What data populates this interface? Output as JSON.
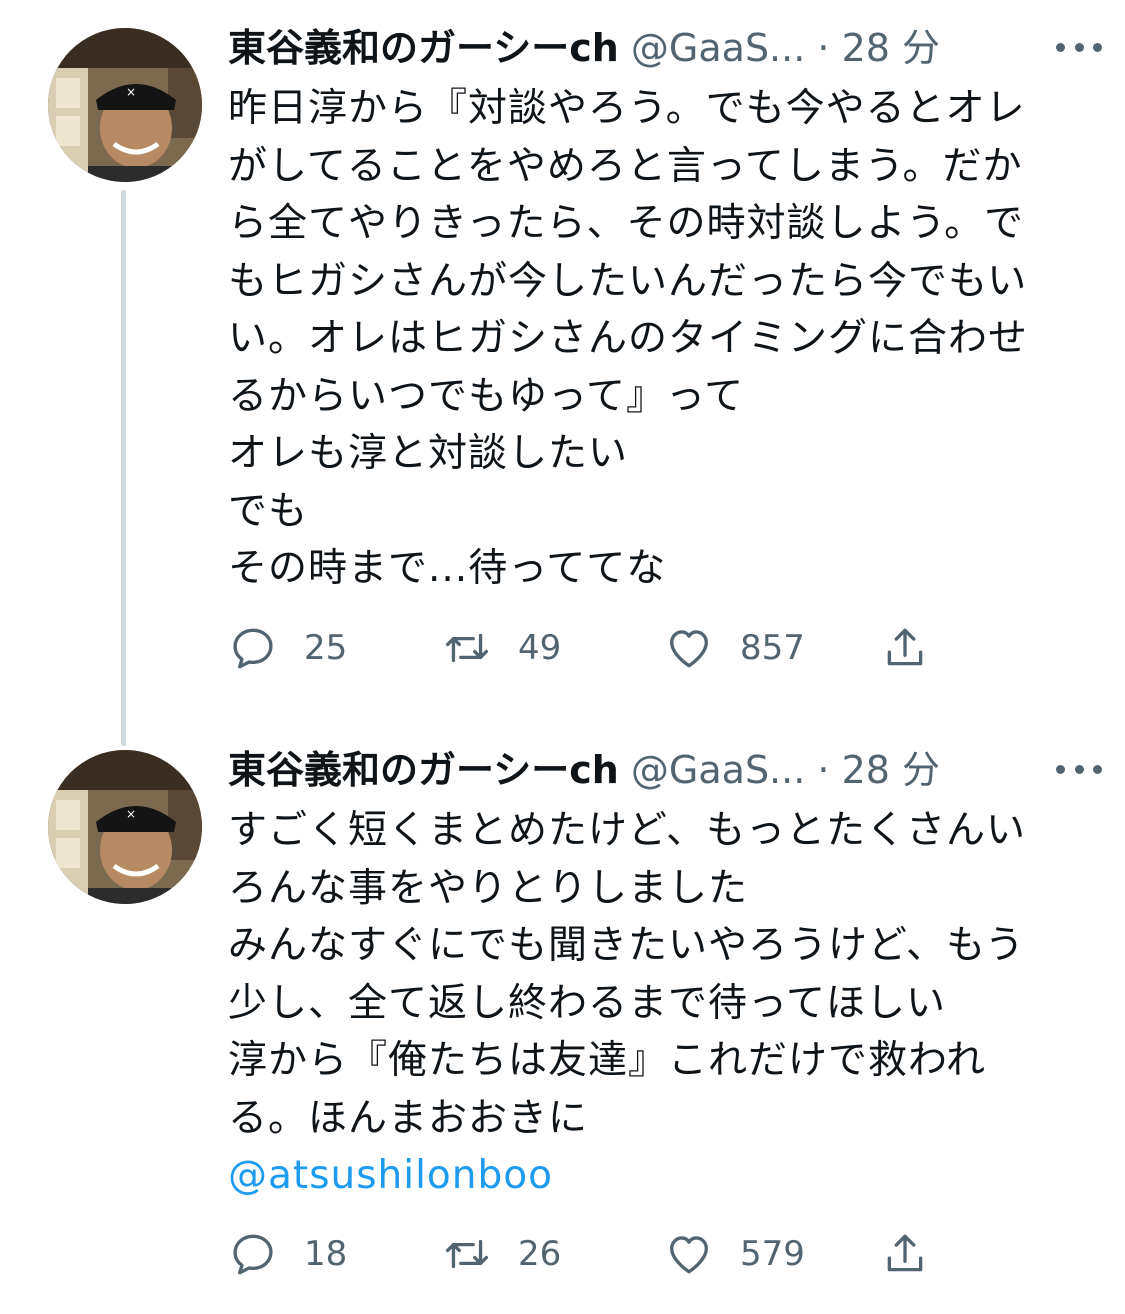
{
  "tweets": [
    {
      "display_name": "東谷義和のガーシーch",
      "handle": "@GaaS...",
      "separator": "·",
      "time": "28 分",
      "lines": [
        "昨日淳から『対談やろう。でも今やるとオレ",
        "がしてることをやめろと言ってしまう。だか",
        "ら全てやりきったら、その時対談しよう。で",
        "もヒガシさんが今したいんだったら今でもい",
        "い。オレはヒガシさんのタイミングに合わせ",
        "るからいつでもゆって』って",
        "オレも淳と対談したい",
        "でも",
        "その時まで...待っててな"
      ],
      "mention": "",
      "replies": "25",
      "retweets": "49",
      "likes": "857"
    },
    {
      "display_name": "東谷義和のガーシーch",
      "handle": "@GaaS...",
      "separator": "·",
      "time": "28 分",
      "lines": [
        "すごく短くまとめたけど、もっとたくさんい",
        "ろんな事をやりとりしました",
        "みんなすぐにでも聞きたいやろうけど、もう",
        "少し、全て返し終わるまで待ってほしい",
        "淳から『俺たちは友達』これだけで救われ",
        "る。ほんまおおきに"
      ],
      "mention": "@atsushilonboo",
      "replies": "18",
      "retweets": "26",
      "likes": "579"
    }
  ],
  "icons": {
    "reply": "speech-bubble-icon",
    "retweet": "retweet-arrows-icon",
    "like": "heart-icon",
    "share": "share-upload-icon",
    "more": "ellipsis-icon"
  },
  "colors": {
    "text": "#0f1419",
    "secondary": "#536471",
    "link": "#1d9bf0",
    "thread_line": "#cfd9de"
  }
}
